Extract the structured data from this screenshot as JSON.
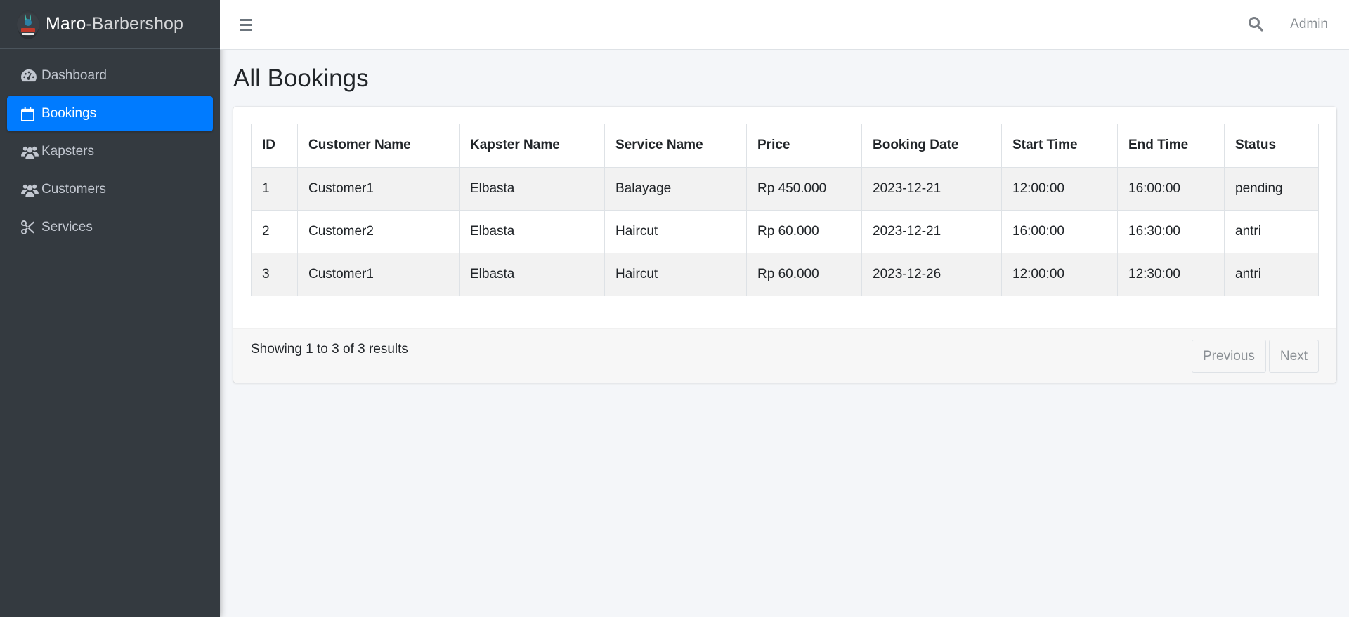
{
  "brand": {
    "name_strong": "Maro",
    "name_light": "-Barbershop"
  },
  "sidebar": {
    "items": [
      {
        "label": "Dashboard",
        "icon": "tachometer-icon",
        "active": false
      },
      {
        "label": "Bookings",
        "icon": "calendar-icon",
        "active": true
      },
      {
        "label": "Kapsters",
        "icon": "users-icon",
        "active": false
      },
      {
        "label": "Customers",
        "icon": "users-icon",
        "active": false
      },
      {
        "label": "Services",
        "icon": "scissors-icon",
        "active": false
      }
    ]
  },
  "topbar": {
    "user_label": "Admin"
  },
  "page": {
    "title": "All Bookings"
  },
  "table": {
    "headers": [
      "ID",
      "Customer Name",
      "Kapster Name",
      "Service Name",
      "Price",
      "Booking Date",
      "Start Time",
      "End Time",
      "Status"
    ],
    "rows": [
      [
        "1",
        "Customer1",
        "Elbasta",
        "Balayage",
        "Rp 450.000",
        "2023-12-21",
        "12:00:00",
        "16:00:00",
        "pending"
      ],
      [
        "2",
        "Customer2",
        "Elbasta",
        "Haircut",
        "Rp 60.000",
        "2023-12-21",
        "16:00:00",
        "16:30:00",
        "antri"
      ],
      [
        "3",
        "Customer1",
        "Elbasta",
        "Haircut",
        "Rp 60.000",
        "2023-12-26",
        "12:00:00",
        "12:30:00",
        "antri"
      ]
    ]
  },
  "pagination": {
    "summary": "Showing 1 to 3 of 3 results",
    "previous": "Previous",
    "next": "Next"
  },
  "colors": {
    "sidebar_bg": "#343a40",
    "accent": "#007bff",
    "content_bg": "#f4f6f9"
  }
}
